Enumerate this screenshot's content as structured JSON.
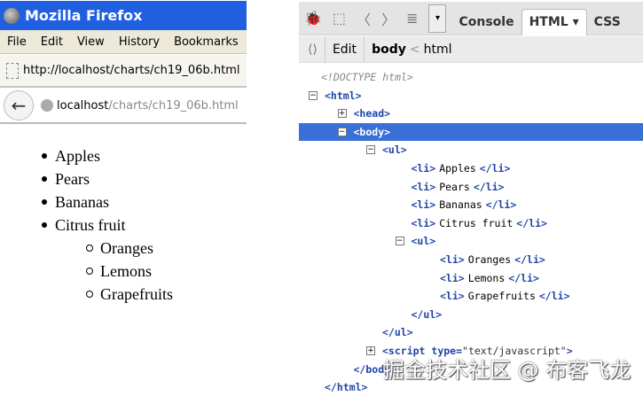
{
  "browser": {
    "title": "Mozilla Firefox",
    "menu": [
      "File",
      "Edit",
      "View",
      "History",
      "Bookmarks"
    ],
    "url": "http://localhost/charts/ch19_06b.html",
    "host": "localhost",
    "path": "/charts/ch19_06b.html"
  },
  "page": {
    "items": [
      "Apples",
      "Pears",
      "Bananas",
      "Citrus fruit"
    ],
    "subitems": [
      "Oranges",
      "Lemons",
      "Grapefruits"
    ]
  },
  "firebug": {
    "tabs": {
      "console": "Console",
      "html": "HTML ▾",
      "css": "CSS"
    },
    "edit": "Edit",
    "crumb_current": "body",
    "crumb_sep": "<",
    "crumb_parent": "html",
    "lines": [
      {
        "depth": 0,
        "toggle": "",
        "parts": [
          [
            "doc",
            "<!DOCTYPE html>"
          ]
        ]
      },
      {
        "depth": 0,
        "toggle": "−",
        "parts": [
          [
            "tag",
            "<html>"
          ]
        ]
      },
      {
        "depth": 1,
        "toggle": "+",
        "parts": [
          [
            "tag",
            "<head>"
          ]
        ]
      },
      {
        "depth": 1,
        "toggle": "−",
        "selected": true,
        "parts": [
          [
            "tag",
            "<body>"
          ]
        ]
      },
      {
        "depth": 2,
        "toggle": "−",
        "parts": [
          [
            "tag",
            "<ul>"
          ]
        ]
      },
      {
        "depth": 3,
        "toggle": "",
        "parts": [
          [
            "tag",
            "<li>"
          ],
          [
            "txt",
            "Apples"
          ],
          [
            "tag",
            "</li>"
          ]
        ]
      },
      {
        "depth": 3,
        "toggle": "",
        "parts": [
          [
            "tag",
            "<li>"
          ],
          [
            "txt",
            "Pears"
          ],
          [
            "tag",
            "</li>"
          ]
        ]
      },
      {
        "depth": 3,
        "toggle": "",
        "parts": [
          [
            "tag",
            "<li>"
          ],
          [
            "txt",
            "Bananas"
          ],
          [
            "tag",
            "</li>"
          ]
        ]
      },
      {
        "depth": 3,
        "toggle": "",
        "parts": [
          [
            "tag",
            "<li>"
          ],
          [
            "txt",
            "Citrus fruit"
          ],
          [
            "tag",
            "</li>"
          ]
        ]
      },
      {
        "depth": 3,
        "toggle": "−",
        "parts": [
          [
            "tag",
            "<ul>"
          ]
        ]
      },
      {
        "depth": 4,
        "toggle": "",
        "parts": [
          [
            "tag",
            "<li>"
          ],
          [
            "txt",
            "Oranges"
          ],
          [
            "tag",
            "</li>"
          ]
        ]
      },
      {
        "depth": 4,
        "toggle": "",
        "parts": [
          [
            "tag",
            "<li>"
          ],
          [
            "txt",
            "Lemons"
          ],
          [
            "tag",
            "</li>"
          ]
        ]
      },
      {
        "depth": 4,
        "toggle": "",
        "parts": [
          [
            "tag",
            "<li>"
          ],
          [
            "txt",
            "Grapefruits"
          ],
          [
            "tag",
            "</li>"
          ]
        ]
      },
      {
        "depth": 3,
        "toggle": "",
        "parts": [
          [
            "tag",
            "</ul>"
          ]
        ]
      },
      {
        "depth": 2,
        "toggle": "",
        "parts": [
          [
            "tag",
            "</ul>"
          ]
        ]
      },
      {
        "depth": 2,
        "toggle": "+",
        "parts": [
          [
            "tag",
            "<script "
          ],
          [
            "attr",
            "type="
          ],
          [
            "val",
            "\"text/javascript\""
          ],
          [
            "tag",
            ">"
          ]
        ]
      },
      {
        "depth": 1,
        "toggle": "",
        "parts": [
          [
            "tag",
            "</body>"
          ]
        ]
      },
      {
        "depth": 0,
        "toggle": "",
        "parts": [
          [
            "tag",
            "</html>"
          ]
        ]
      }
    ]
  },
  "watermark": "掘金技术社区 @ 布客飞龙"
}
